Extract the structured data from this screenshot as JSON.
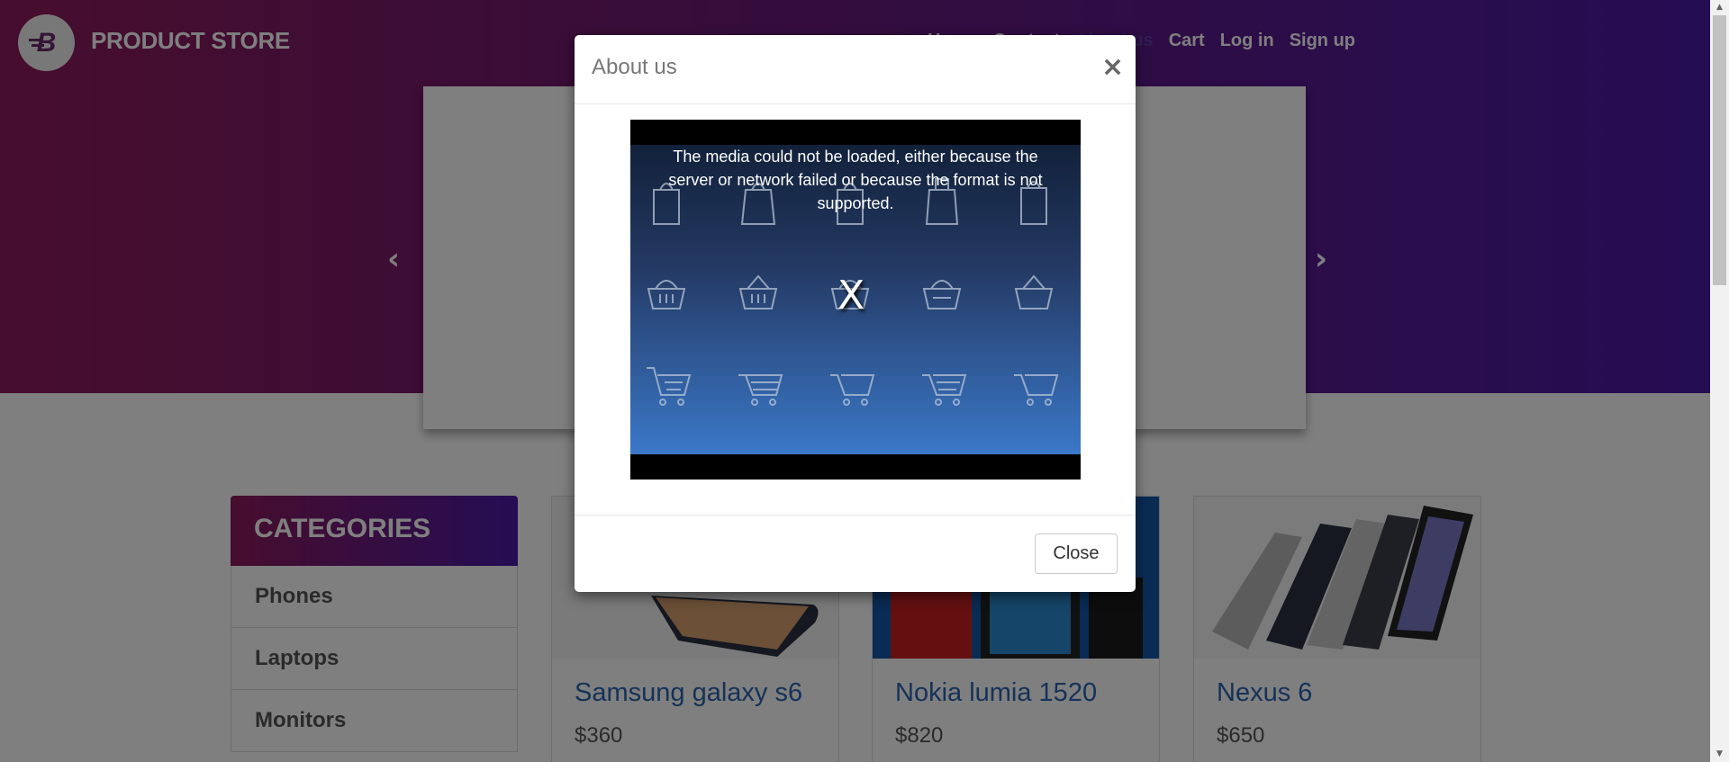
{
  "header": {
    "brand_letter": "B",
    "brand_name": "PRODUCT STORE",
    "nav": [
      "Home",
      "Contact",
      "About us",
      "Cart",
      "Log in",
      "Sign up"
    ]
  },
  "carousel": {
    "prev_icon": "chevron-left-icon",
    "next_icon": "chevron-right-icon"
  },
  "categories": {
    "title": "CATEGORIES",
    "items": [
      "Phones",
      "Laptops",
      "Monitors"
    ]
  },
  "products": [
    {
      "name": "Samsung galaxy s6",
      "price": "$360"
    },
    {
      "name": "Nokia lumia 1520",
      "price": "$820"
    },
    {
      "name": "Nexus 6",
      "price": "$650"
    }
  ],
  "modal": {
    "title": "About us",
    "close_symbol": "×",
    "video_error": "The media could not be loaded, either because the server or network failed or because the format is not supported.",
    "video_error_mark": "X",
    "close_label": "Close"
  },
  "colors": {
    "hero_start": "#8e1a5b",
    "hero_end": "#4a1aa8",
    "link_blue": "#2a64b0"
  }
}
